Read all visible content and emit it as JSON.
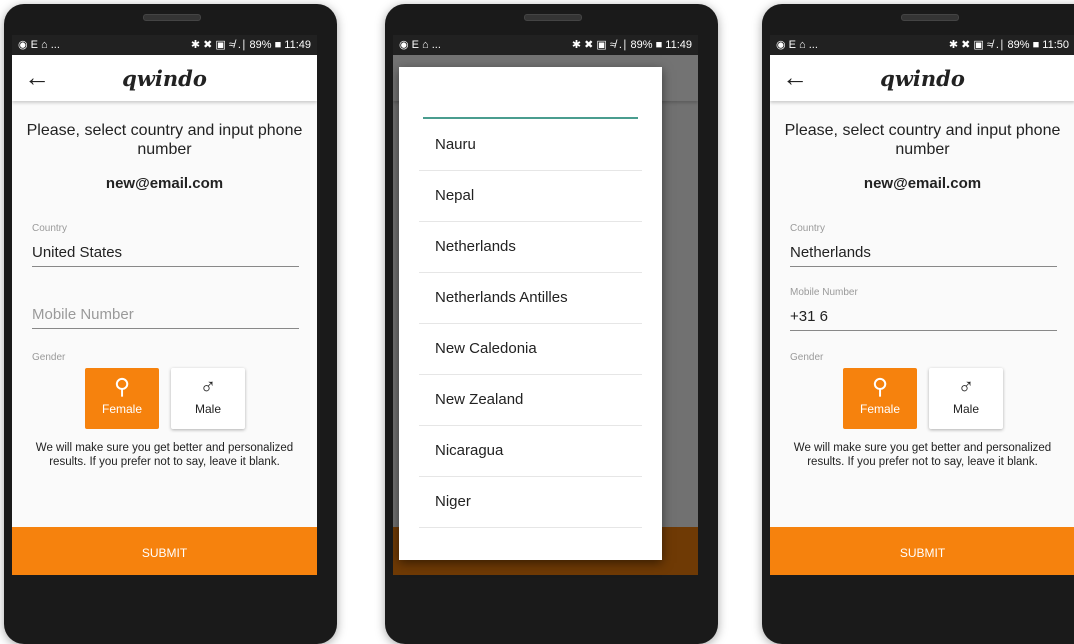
{
  "status_left": "◉ E ⌂ ...",
  "status_right_1": "✱ ✖ ▣ ≉ .∣ 89% ■ 11:49",
  "status_right_3": "✱ ✖ ▣ ≉ .∣ 89% ■ 11:50",
  "app": {
    "logo": "qwindo",
    "back_arrow": "←",
    "instruction": "Please, select country and input phone number",
    "email": "new@email.com",
    "country_label": "Country",
    "mobile_label": "Mobile Number",
    "gender_label": "Gender",
    "female": "Female",
    "male": "Male",
    "female_symbol": "⚲",
    "male_symbol": "♂",
    "gender_desc": "We will make sure you get better and personalized results. If you prefer not to say, leave it blank.",
    "submit": "SUBMIT",
    "accent_color": "#f6820d"
  },
  "screen1": {
    "country_value": "United States",
    "mobile_placeholder": "Mobile Number"
  },
  "screen2": {
    "countries": [
      "Nauru",
      "Nepal",
      "Netherlands",
      "Netherlands Antilles",
      "New Caledonia",
      "New Zealand",
      "Nicaragua",
      "Niger"
    ]
  },
  "screen3": {
    "country_value": "Netherlands",
    "mobile_value": "+31 6"
  }
}
